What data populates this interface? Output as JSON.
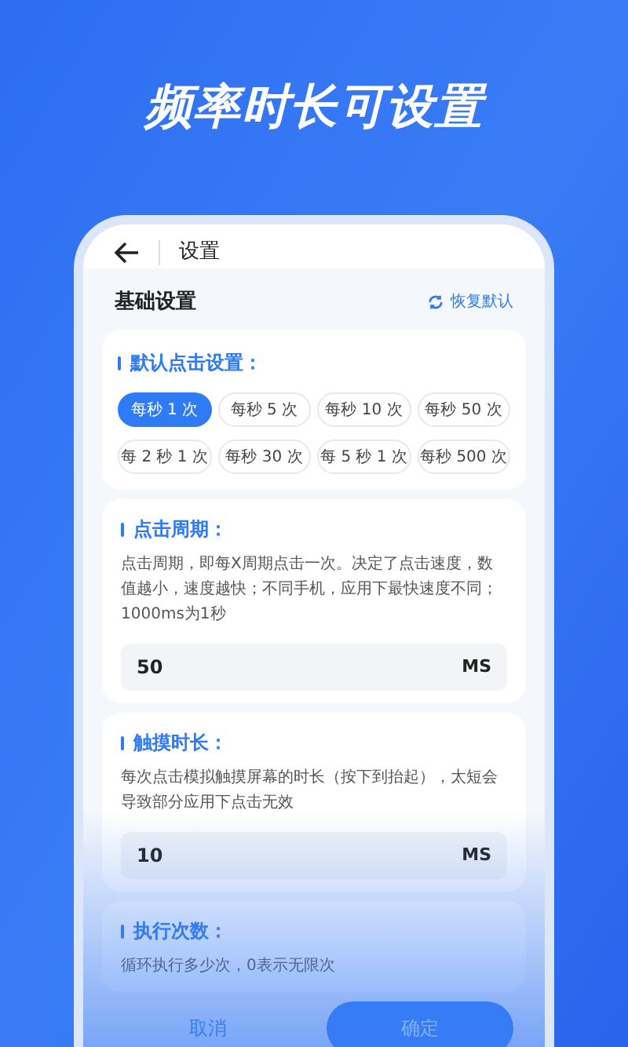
{
  "headline": "频率时长可设置",
  "header": {
    "title": "设置"
  },
  "section": {
    "title": "基础设置",
    "reset": "恢复默认"
  },
  "default_card": {
    "title": "默认点击设置：",
    "chips": [
      {
        "label": "每秒 1 次",
        "selected": true
      },
      {
        "label": "每秒 5 次",
        "selected": false
      },
      {
        "label": "每秒 10 次",
        "selected": false
      },
      {
        "label": "每秒 50 次",
        "selected": false
      },
      {
        "label": "每 2 秒 1 次",
        "selected": false
      },
      {
        "label": "每秒 30 次",
        "selected": false
      },
      {
        "label": "每 5 秒 1 次",
        "selected": false
      },
      {
        "label": "每秒 500 次",
        "selected": false
      }
    ]
  },
  "cards": [
    {
      "title": "点击周期：",
      "description": "点击周期，即每X周期点击一次。决定了点击速度，数值越小，速度越快；不同手机，应用下最快速度不同；1000ms为1秒",
      "value": "50",
      "unit": "MS"
    },
    {
      "title": "触摸时长：",
      "description": "每次点击模拟触摸屏幕的时长（按下到抬起），太短会导致部分应用下点击无效",
      "value": "10",
      "unit": "MS"
    },
    {
      "title": "执行次数：",
      "description": "循环执行多少次，0表示无限次"
    }
  ],
  "buttons": {
    "cancel": "取消",
    "confirm": "确定"
  }
}
